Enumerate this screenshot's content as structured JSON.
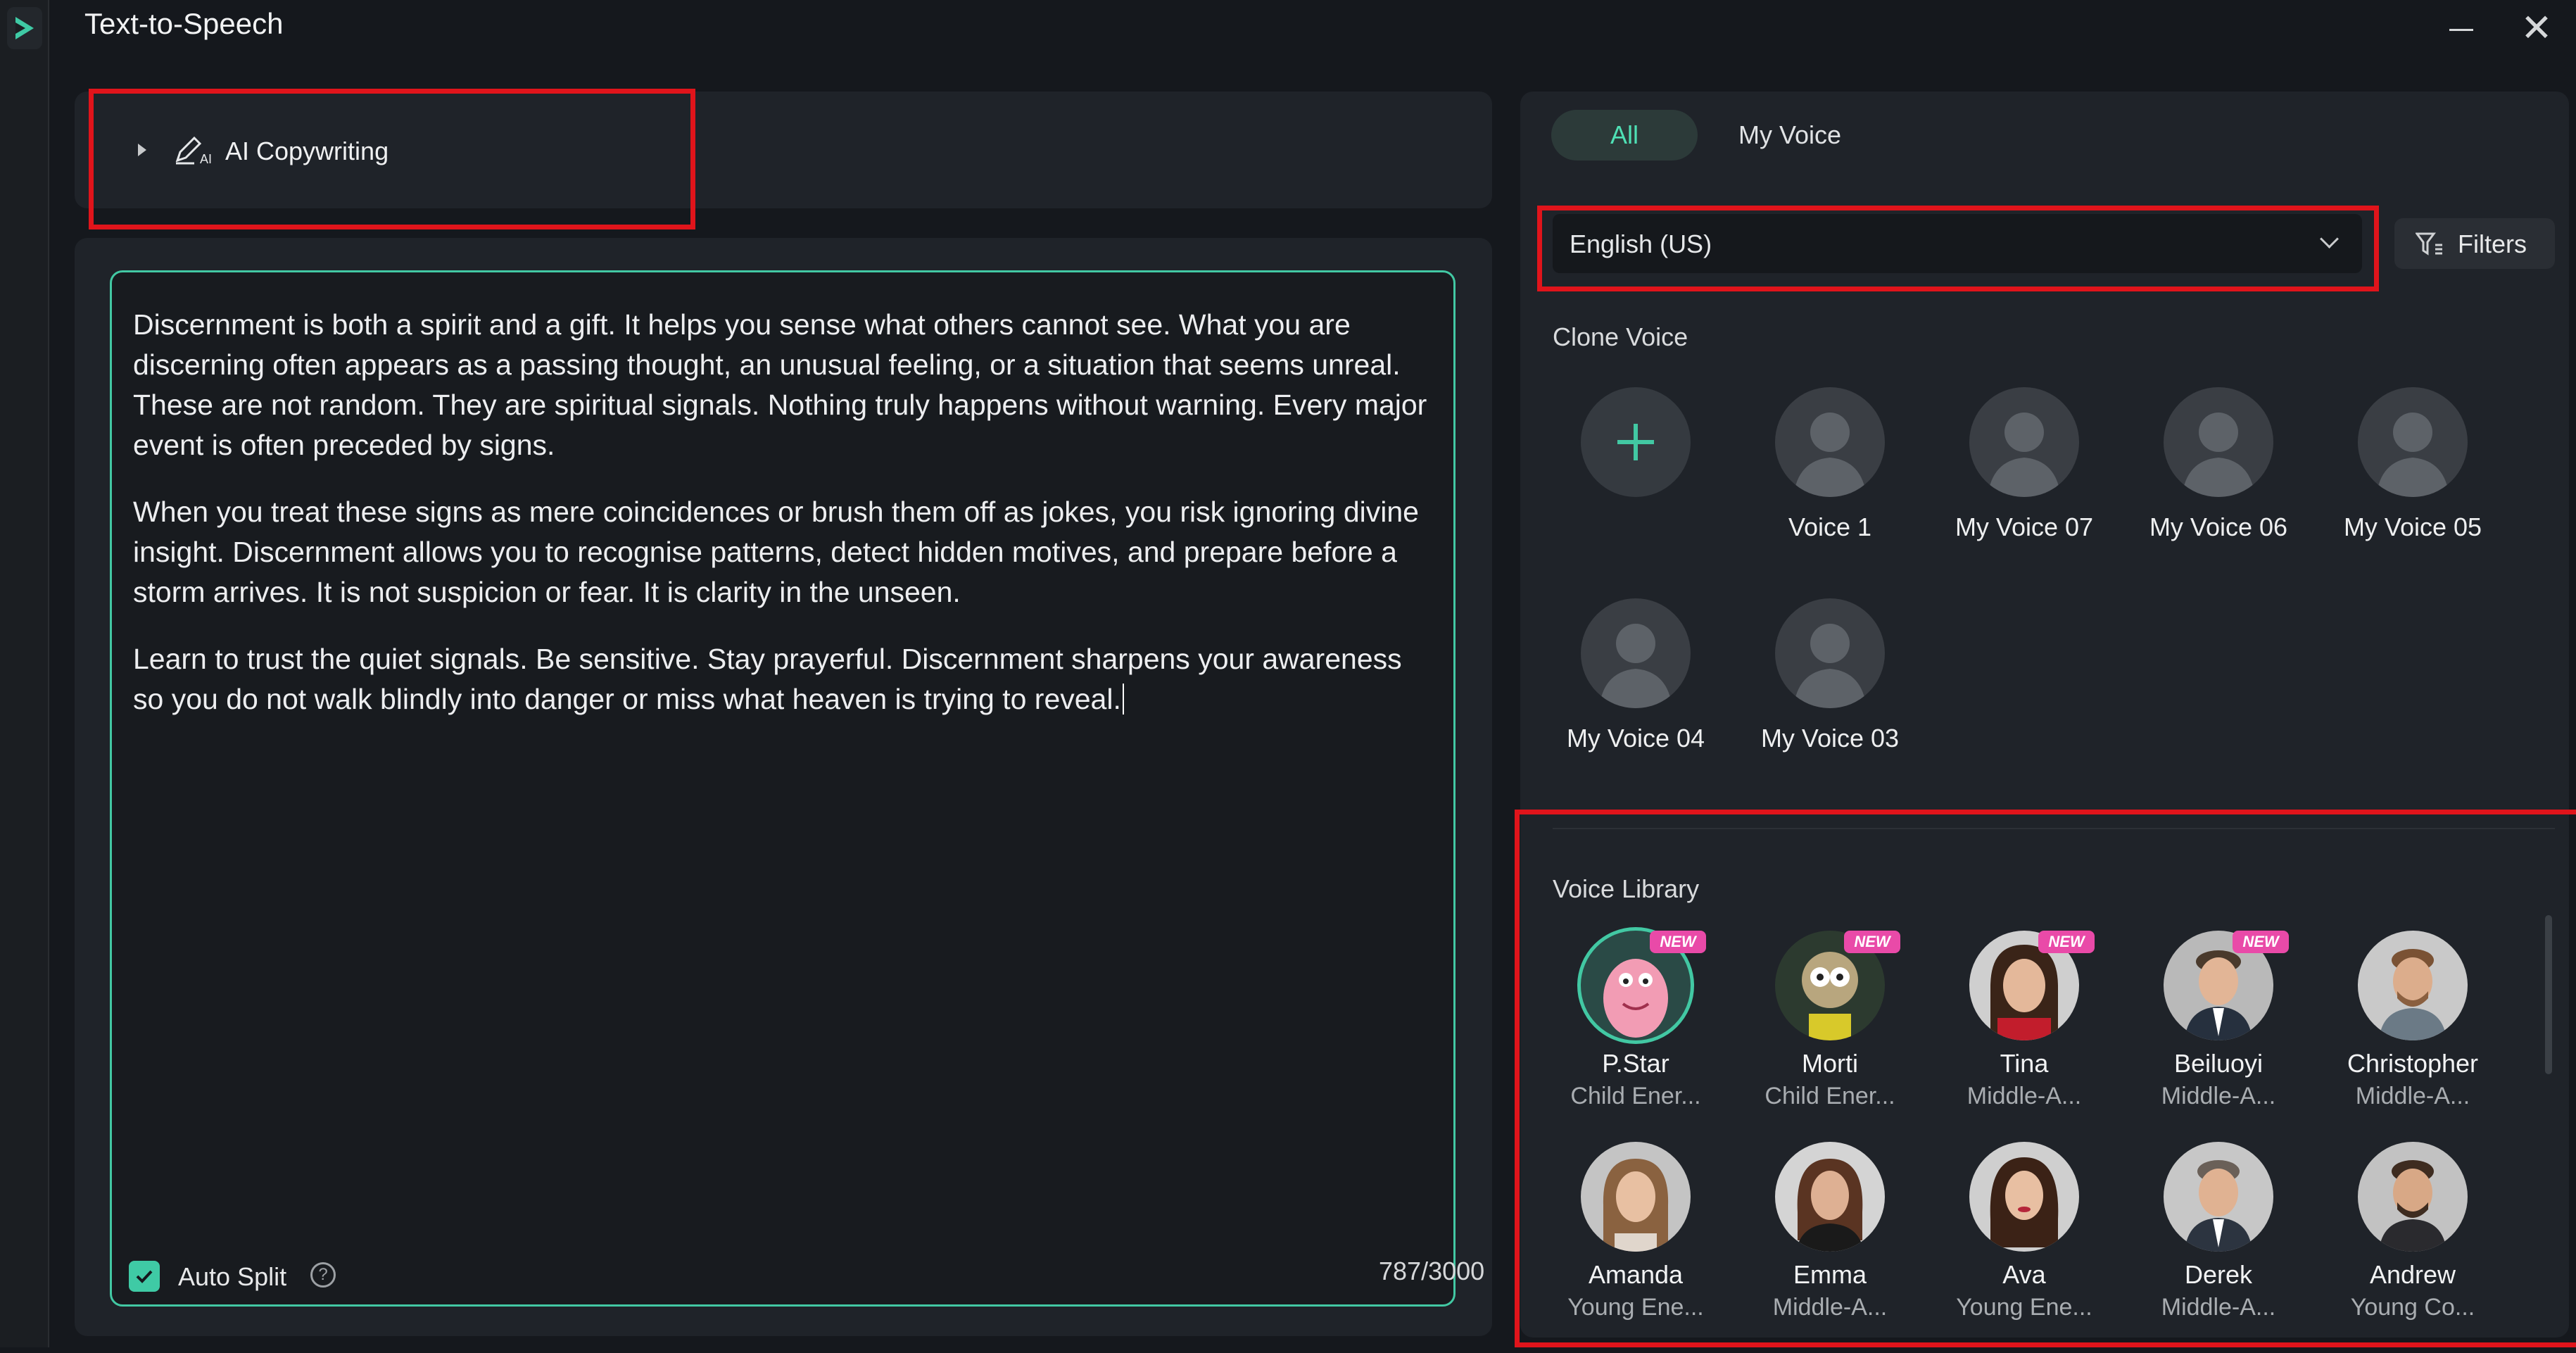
{
  "window": {
    "title": "Text-to-Speech"
  },
  "left": {
    "ai_copywriting_label": "AI Copywriting",
    "editor_paragraphs": [
      "Discernment is both a spirit and a gift. It helps you sense what others cannot see. What you are discerning often appears as a passing thought, an unusual feeling, or a situation that seems unreal. These are not random. They are spiritual signals. Nothing truly happens without warning. Every major event is often preceded by signs.",
      "When you treat these signs as mere coincidences or brush them off as jokes, you risk ignoring divine insight. Discernment allows you to recognise patterns, detect hidden motives, and prepare before a storm arrives. It is not suspicion or fear. It is clarity in the unseen.",
      "Learn to trust the quiet signals. Be sensitive. Stay prayerful. Discernment sharpens your awareness so you do not walk blindly into danger or miss what heaven is trying to reveal."
    ],
    "auto_split_label": "Auto Split",
    "auto_split_checked": true,
    "char_counter": "787/3000"
  },
  "right": {
    "tabs": [
      {
        "label": "All",
        "active": true
      },
      {
        "label": "My Voice",
        "active": false
      }
    ],
    "language_selected": "English (US)",
    "filters_label": "Filters",
    "clone_voice_title": "Clone Voice",
    "clone_voices": [
      "Voice 1",
      "My Voice 07",
      "My Voice 06",
      "My Voice 05",
      "My Voice 04",
      "My Voice 03"
    ],
    "voice_library_title": "Voice Library",
    "library": [
      {
        "name": "P.Star",
        "desc": "Child Ener...",
        "badge": "NEW",
        "selected": true
      },
      {
        "name": "Morti",
        "desc": "Child Ener...",
        "badge": "NEW"
      },
      {
        "name": "Tina",
        "desc": "Middle-A...",
        "badge": "NEW"
      },
      {
        "name": "Beiluoyi",
        "desc": "Middle-A...",
        "badge": "NEW"
      },
      {
        "name": "Christopher",
        "desc": "Middle-A..."
      },
      {
        "name": "Amanda",
        "desc": "Young Ene..."
      },
      {
        "name": "Emma",
        "desc": "Middle-A..."
      },
      {
        "name": "Ava",
        "desc": "Young Ene..."
      },
      {
        "name": "Derek",
        "desc": "Middle-A..."
      },
      {
        "name": "Andrew",
        "desc": "Young Co..."
      }
    ]
  },
  "colors": {
    "accent": "#42c8a3",
    "highlight": "#e0141b",
    "new_badge": "#e94aa8"
  }
}
